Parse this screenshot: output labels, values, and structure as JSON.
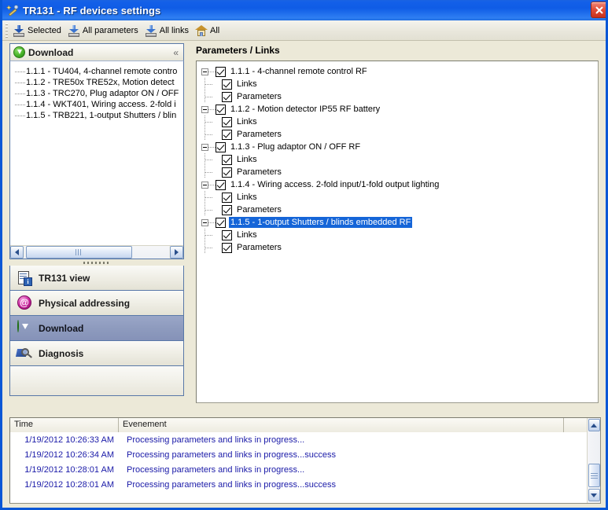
{
  "window": {
    "title": "TR131 - RF devices settings",
    "icon": "tools-wand-icon",
    "close_label": "×"
  },
  "toolbar": {
    "items": [
      {
        "label": "Selected",
        "icon": "download-selected-icon"
      },
      {
        "label": "All parameters",
        "icon": "download-parameters-icon"
      },
      {
        "label": "All links",
        "icon": "download-links-icon"
      },
      {
        "label": "All",
        "icon": "house-all-icon"
      }
    ]
  },
  "sidebar": {
    "group_header": {
      "title": "Download",
      "icon": "download-green-icon",
      "collapse_label": "«"
    },
    "device_list": [
      {
        "label": "1.1.1 - TU404, 4-channel remote contro"
      },
      {
        "label": "1.1.2 - TRE50x TRE52x, Motion detect"
      },
      {
        "label": "1.1.3 - TRC270, Plug adaptor ON / OFF"
      },
      {
        "label": "1.1.4 - WKT401, Wiring access. 2-fold i"
      },
      {
        "label": "1.1.5 - TRB221, 1-output Shutters / blin"
      }
    ],
    "nav_items": [
      {
        "label": "TR131 view",
        "icon": "document-info-icon",
        "active": false
      },
      {
        "label": "Physical addressing",
        "icon": "at-sign-icon",
        "active": false
      },
      {
        "label": "Download",
        "icon": "download-green-icon",
        "active": true
      },
      {
        "label": "Diagnosis",
        "icon": "magnifier-icon",
        "active": false
      }
    ]
  },
  "main": {
    "title": "Parameters / Links",
    "tree": [
      {
        "label": "1.1.1 - 4-channel remote control RF",
        "checked": true,
        "expanded": true,
        "selected": false,
        "children": [
          {
            "label": "Links",
            "checked": true
          },
          {
            "label": "Parameters",
            "checked": true
          }
        ]
      },
      {
        "label": "1.1.2 - Motion detector IP55 RF battery",
        "checked": true,
        "expanded": true,
        "selected": false,
        "children": [
          {
            "label": "Links",
            "checked": true
          },
          {
            "label": "Parameters",
            "checked": true
          }
        ]
      },
      {
        "label": "1.1.3 - Plug adaptor ON / OFF RF",
        "checked": true,
        "expanded": true,
        "selected": false,
        "children": [
          {
            "label": "Links",
            "checked": true
          },
          {
            "label": "Parameters",
            "checked": true
          }
        ]
      },
      {
        "label": "1.1.4 - Wiring access. 2-fold input/1-fold output lighting",
        "checked": true,
        "expanded": true,
        "selected": false,
        "children": [
          {
            "label": "Links",
            "checked": true
          },
          {
            "label": "Parameters",
            "checked": true
          }
        ]
      },
      {
        "label": "1.1.5 - 1-output Shutters / blinds embedded RF",
        "checked": true,
        "expanded": true,
        "selected": true,
        "children": [
          {
            "label": "Links",
            "checked": true
          },
          {
            "label": "Parameters",
            "checked": true
          }
        ]
      }
    ]
  },
  "log": {
    "columns": [
      "Time",
      "Evenement",
      ""
    ],
    "rows": [
      {
        "time": "1/19/2012 10:26:33 AM",
        "message": "Processing parameters and links in progress..."
      },
      {
        "time": "1/19/2012 10:26:34 AM",
        "message": "Processing parameters and links in progress...success"
      },
      {
        "time": "1/19/2012 10:28:01 AM",
        "message": "Processing parameters and links in progress..."
      },
      {
        "time": "1/19/2012 10:28:01 AM",
        "message": "Processing parameters and links in progress...success"
      }
    ]
  },
  "colors": {
    "titlebar_blue": "#0f5ce6",
    "selection_blue": "#1565d8",
    "log_text_blue": "#1a1aa8",
    "window_beige": "#ece9d8",
    "nav_active": "#8e9bbe",
    "close_red": "#c8301c"
  }
}
